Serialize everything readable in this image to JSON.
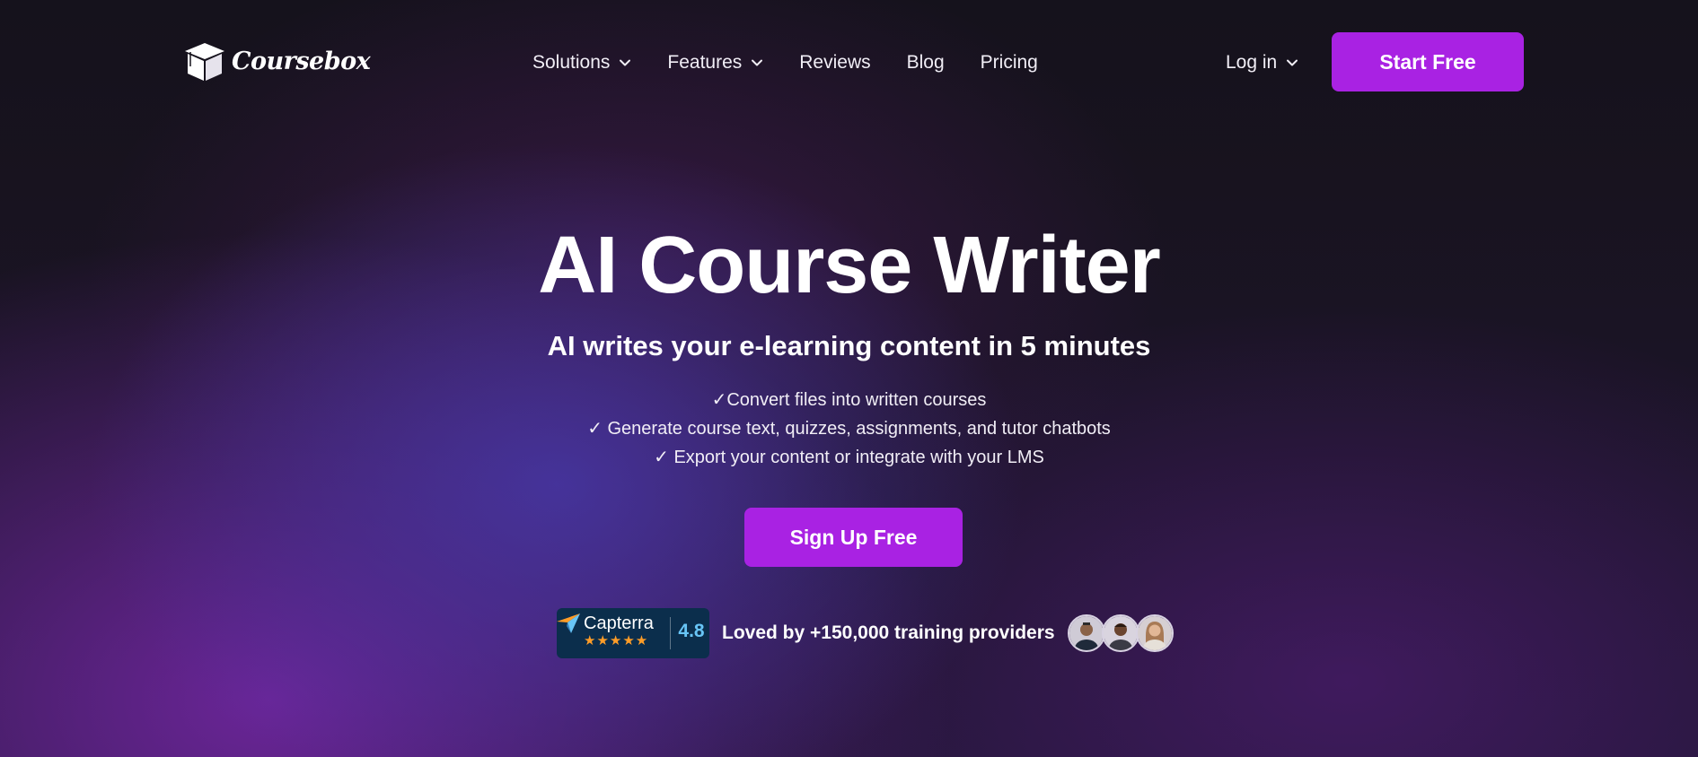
{
  "header": {
    "logo_text": "Coursebox",
    "nav": [
      {
        "label": "Solutions",
        "icon": "chevron-down-icon"
      },
      {
        "label": "Features",
        "icon": "chevron-down-icon"
      },
      {
        "label": "Reviews"
      },
      {
        "label": "Blog"
      },
      {
        "label": "Pricing"
      }
    ],
    "login_label": "Log in",
    "start_label": "Start Free"
  },
  "hero": {
    "title": "AI Course Writer",
    "subtitle": "AI writes your e-learning content in 5 minutes",
    "benefits": [
      "✓Convert files into written courses",
      "✓ Generate course text, quizzes, assignments, and tutor chatbots",
      "✓ Export your content or integrate with your LMS"
    ],
    "cta_label": "Sign Up Free"
  },
  "social_proof": {
    "capterra_name": "Capterra",
    "capterra_stars": "★★★★★",
    "capterra_score": "4.8",
    "loved_text": "Loved by +150,000 training providers",
    "avatars": [
      "user-avatar-1",
      "user-avatar-2",
      "user-avatar-3"
    ]
  },
  "colors": {
    "accent": "#a922e3",
    "background": "#15121c",
    "capterra_badge": "#0b2e4c",
    "capterra_score": "#68c5f6",
    "stars": "#ff9d28"
  }
}
